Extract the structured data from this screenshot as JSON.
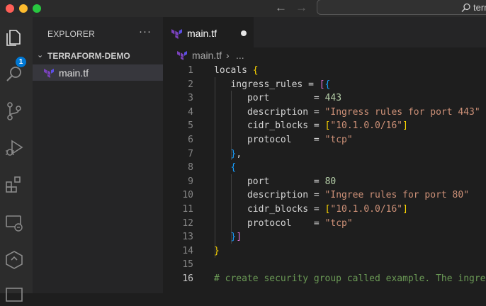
{
  "titlebar": {
    "back_icon": "←",
    "forward_icon": "→",
    "search_text": "terra"
  },
  "activity": {
    "explorer_badge": "1"
  },
  "explorer": {
    "title": "EXPLORER",
    "more": "···",
    "folder": "TERRAFORM-DEMO",
    "file": "main.tf"
  },
  "tab": {
    "label": "main.tf"
  },
  "breadcrumb": {
    "file": "main.tf",
    "sep": "›",
    "more": "..."
  },
  "code": {
    "line_numbers": [
      "1",
      "2",
      "3",
      "4",
      "5",
      "6",
      "7",
      "8",
      "9",
      "10",
      "11",
      "12",
      "13",
      "14",
      "15",
      "16"
    ],
    "l1": {
      "kw": "locals",
      "open": "{"
    },
    "l2": {
      "kw": "ingress_rules",
      "eq": "=",
      "open_sq": "[",
      "open_br": "{"
    },
    "l3": {
      "kw": "port",
      "eq": "=",
      "val": "443"
    },
    "l4": {
      "kw": "description",
      "eq": "=",
      "val": "\"Ingress rules for port 443\""
    },
    "l5": {
      "kw": "cidr_blocks",
      "eq": "=",
      "open": "[",
      "val": "\"10.1.0.0/16\"",
      "close": "]"
    },
    "l6": {
      "kw": "protocol",
      "eq": "=",
      "val": "\"tcp\""
    },
    "l7": {
      "close": "}",
      "comma": ","
    },
    "l8": {
      "open": "{"
    },
    "l9": {
      "kw": "port",
      "eq": "=",
      "val": "80"
    },
    "l10": {
      "kw": "description",
      "eq": "=",
      "val": "\"Ingree rules for port 80\""
    },
    "l11": {
      "kw": "cidr_blocks",
      "eq": "=",
      "open": "[",
      "val": "\"10.1.0.0/16\"",
      "close": "]"
    },
    "l12": {
      "kw": "protocol",
      "eq": "=",
      "val": "\"tcp\""
    },
    "l13": {
      "close_br": "}",
      "close_sq": "]"
    },
    "l14": {
      "close": "}"
    },
    "l16": {
      "comment": "# create security group called example. The ingress"
    }
  },
  "colors": {
    "accent": "#0078d4",
    "terraform": "#7b42bc"
  }
}
